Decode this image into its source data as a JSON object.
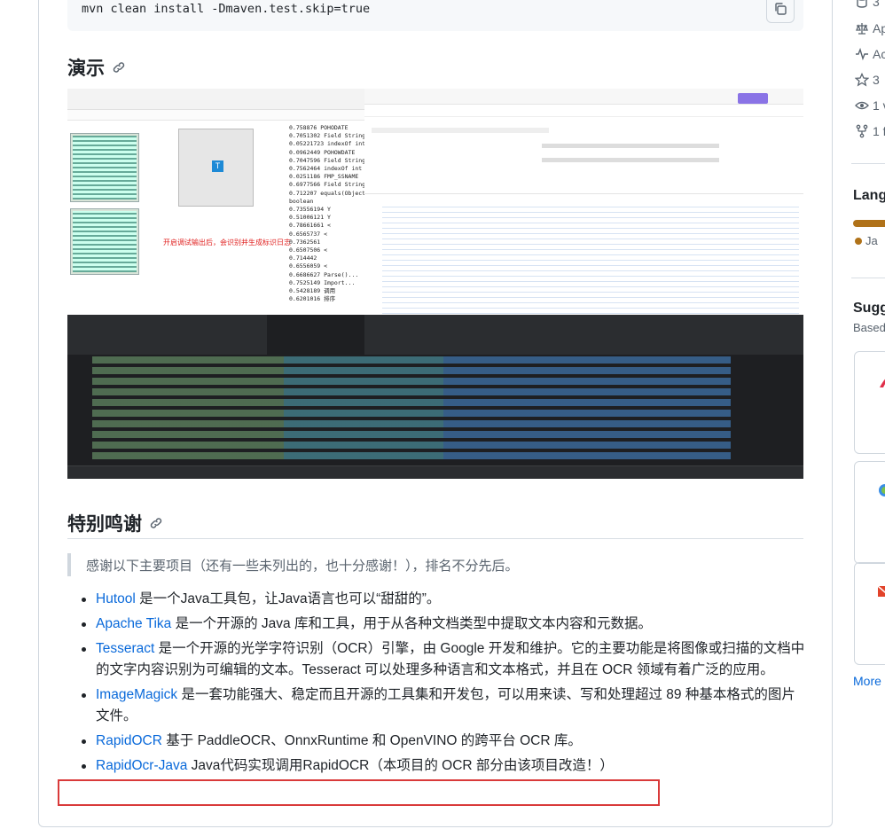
{
  "code": {
    "command": "mvn clean install -Dmaven.test.skip=true",
    "copy_icon": "copy-icon"
  },
  "demo_section": {
    "title": "演示",
    "image_note": "开启调试输出后，会识别并生成标识日志"
  },
  "thanks_section": {
    "title": "特别鸣谢",
    "quote": "感谢以下主要项目（还有一些未列出的，也十分感谢！），排名不分先后。",
    "items": [
      {
        "link": "Hutool",
        "text": " 是一个Java工具包，让Java语言也可以“甜甜的”。"
      },
      {
        "link": "Apache Tika",
        "text": " 是一个开源的 Java 库和工具，用于从各种文档类型中提取文本内容和元数据。"
      },
      {
        "link": "Tesseract",
        "text": " 是一个开源的光学字符识别（OCR）引擎，由 Google 开发和维护。它的主要功能是将图像或扫描的文档中的文字内容识别为可编辑的文本。Tesseract 可以处理多种语言和文本格式，并且在 OCR 领域有着广泛的应用。"
      },
      {
        "link": "ImageMagick",
        "text": " 是一套功能强大、稳定而且开源的工具集和开发包，可以用来读、写和处理超过 89 种基本格式的图片文件。"
      },
      {
        "link": "RapidOCR",
        "text": " 基于 PaddleOCR、OnnxRuntime 和 OpenVINO 的跨平台 OCR 库。"
      },
      {
        "link": "RapidOcr-Java",
        "text": " Java代码实现调用RapidOCR（本项目的 OCR 部分由该项目改造！）"
      }
    ]
  },
  "sidebar": {
    "stats": [
      {
        "icon": "database-icon",
        "text": "3"
      },
      {
        "icon": "law-icon",
        "text": "Ap"
      },
      {
        "icon": "pulse-icon",
        "text": "Ac"
      },
      {
        "icon": "star-icon",
        "text": "3"
      },
      {
        "icon": "eye-icon",
        "text": "1 v"
      },
      {
        "icon": "fork-icon",
        "text": "1 f"
      }
    ],
    "languages_title": "Lang",
    "language_item": "Ja",
    "suggested_title": "Sugg",
    "suggested_sub": "Based",
    "more_label": "More"
  }
}
